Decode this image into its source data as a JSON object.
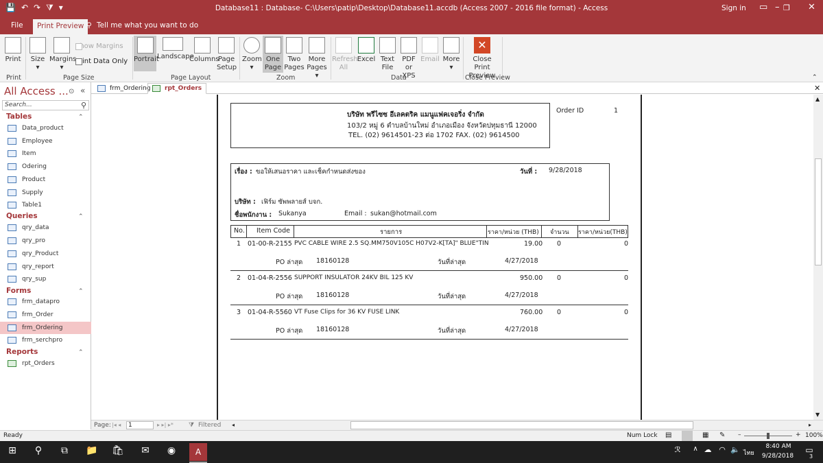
{
  "window": {
    "title": "Database11 : Database- C:\\Users\\patip\\Desktop\\Database11.accdb (Access 2007 - 2016 file format)  -  Access",
    "signin": "Sign in"
  },
  "tabs": {
    "file": "File",
    "print_preview": "Print Preview",
    "tell_me": "Tell me what you want to do"
  },
  "ribbon": {
    "print": "Print",
    "size": "Size",
    "margins": "Margins",
    "show_margins": "Show Margins",
    "print_data_only": "Print Data Only",
    "portrait": "Portrait",
    "landscape": "Landscape",
    "columns": "Columns",
    "page_setup_1": "Page",
    "page_setup_2": "Setup",
    "zoom": "Zoom",
    "one_page_1": "One",
    "one_page_2": "Page",
    "two_pages_1": "Two",
    "two_pages_2": "Pages",
    "more_pages_1": "More",
    "more_pages_2": "Pages",
    "refresh_1": "Refresh",
    "refresh_2": "All",
    "excel": "Excel",
    "text_file_1": "Text",
    "text_file_2": "File",
    "pdf_1": "PDF",
    "pdf_2": "or XPS",
    "email": "Email",
    "more": "More",
    "close_1": "Close Print",
    "close_2": "Preview",
    "groups": {
      "print": "Print",
      "page_size": "Page Size",
      "page_layout": "Page Layout",
      "zoom": "Zoom",
      "data": "Data",
      "close_preview": "Close Preview"
    }
  },
  "nav": {
    "header": "All Access ...",
    "search_placeholder": "Search...",
    "groups": [
      {
        "label": "Tables",
        "items": [
          "Data_product",
          "Employee",
          "Item",
          "Odering",
          "Product",
          "Supply",
          "Table1"
        ]
      },
      {
        "label": "Queries",
        "items": [
          "qry_data",
          "qry_pro",
          "qry_Product",
          "qry_report",
          "qry_sup"
        ]
      },
      {
        "label": "Forms",
        "items": [
          "frm_datapro",
          "frm_Order",
          "frm_Ordering",
          "frm_serchpro"
        ]
      },
      {
        "label": "Reports",
        "items": [
          "rpt_Orders"
        ]
      }
    ]
  },
  "doctabs": [
    "frm_Ordering",
    "rpt_Orders"
  ],
  "report": {
    "company_name": "บริษัท พรีไซซ อีเลคตริค แมนูแฟคเจอริ่ง จำกัด",
    "company_address": "103/2 หมู่ 6 ตำบลบ้านใหม่ อำเภอเมือง จังหวัดปทุมธานี 12000",
    "company_phone": "TEL. (02) 9614501-23 ต่อ 1702 FAX. (02) 9614500",
    "order_id_label": "Order ID",
    "order_id": "1",
    "subject_label": "เรื่อง :",
    "subject": "ขอให้เสนอราคา และเช็คกำหนดส่งของ",
    "date_label": "วันที่ :",
    "date": "9/28/2018",
    "company_label": "บริษัท :",
    "company": "เฟิร์ม ซัพพลายส์ บจก.",
    "employee_label": "ชื่อพนักงาน :",
    "employee": "Sukanya",
    "email_label": "Email :",
    "email": "sukan@hotmail.com",
    "columns": [
      "No.",
      "Item Code",
      "รายการ",
      "ราคา/หน่วย (THB)",
      "จำนวน",
      "ราคา/หน่วย(THB)"
    ],
    "po_label": "PO ล่าสุด",
    "po_date_label": "วันที่ล่าสุด",
    "rows": [
      {
        "no": "1",
        "code": "01-00-R-2155",
        "desc": "PVC CABLE WIRE 2.5 SQ.MM750V105C H07V2-K[TA]\" BLUE\"TIN",
        "price": "19.00",
        "qty": "0",
        "total": "0",
        "po": "18160128",
        "po_date": "4/27/2018"
      },
      {
        "no": "2",
        "code": "01-04-R-2556",
        "desc": "SUPPORT INSULATOR 24KV BIL 125 KV",
        "price": "950.00",
        "qty": "0",
        "total": "0",
        "po": "18160128",
        "po_date": "4/27/2018"
      },
      {
        "no": "3",
        "code": "01-04-R-5560",
        "desc": "VT Fuse Clips for 36 KV FUSE LINK",
        "price": "760.00",
        "qty": "0",
        "total": "0",
        "po": "18160128",
        "po_date": "4/27/2018"
      }
    ]
  },
  "pager": {
    "label": "Page:",
    "page": "1",
    "filter": "Filtered"
  },
  "status": {
    "ready": "Ready",
    "num_lock": "Num Lock",
    "zoom": "100%"
  },
  "taskbar": {
    "time": "8:40 AM",
    "date": "9/28/2018",
    "lang": "ไทย",
    "notif": "3"
  },
  "colors": {
    "accent": "#a4373a",
    "selected_nav": "#f4c6c7"
  }
}
